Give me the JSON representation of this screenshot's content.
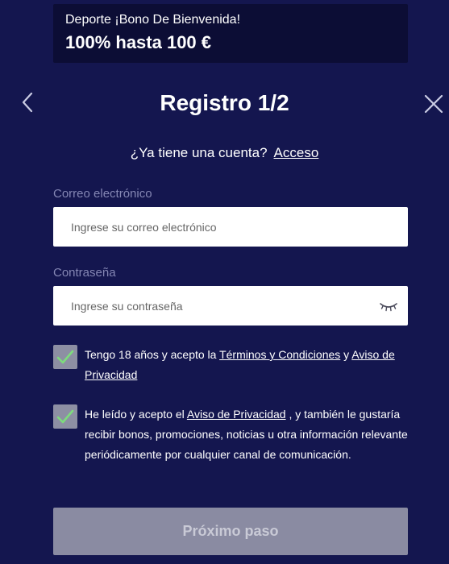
{
  "banner": {
    "line1": "Deporte ¡Bono De Bienvenida!",
    "line2": "100% hasta 100 €"
  },
  "header": {
    "title": "Registro 1/2",
    "back_icon": "chevron-left-icon",
    "close_icon": "close-icon"
  },
  "login_prompt": {
    "question": "¿Ya tiene una cuenta?",
    "link": "Acceso"
  },
  "email": {
    "label": "Correo electrónico",
    "placeholder": "Ingrese su correo electrónico",
    "value": ""
  },
  "password": {
    "label": "Contraseña",
    "placeholder": "Ingrese su contraseña",
    "value": "",
    "visibility_icon": "eye-closed-icon"
  },
  "terms_checkbox": {
    "checked": true,
    "text_before": "Tengo 18 años y acepto la ",
    "link1": "Términos y Condiciones",
    "text_middle": " y ",
    "link2": "Aviso de Privacidad"
  },
  "marketing_checkbox": {
    "checked": true,
    "text_before": "He leído y acepto el ",
    "link": "Aviso de Privacidad",
    "text_after": " , y también le gustaría recibir bonos, promociones, noticias u otra información relevante periódicamente por cualquier canal de comunicación."
  },
  "next_button": {
    "label": "Próximo paso"
  },
  "colors": {
    "background": "#14164f",
    "banner_bg": "#0c0d35",
    "checkbox_bg": "#8d8fa3",
    "check_mark": "#7ddc7d",
    "button_disabled": "#8a8ba2",
    "label_muted": "#8486b3"
  }
}
